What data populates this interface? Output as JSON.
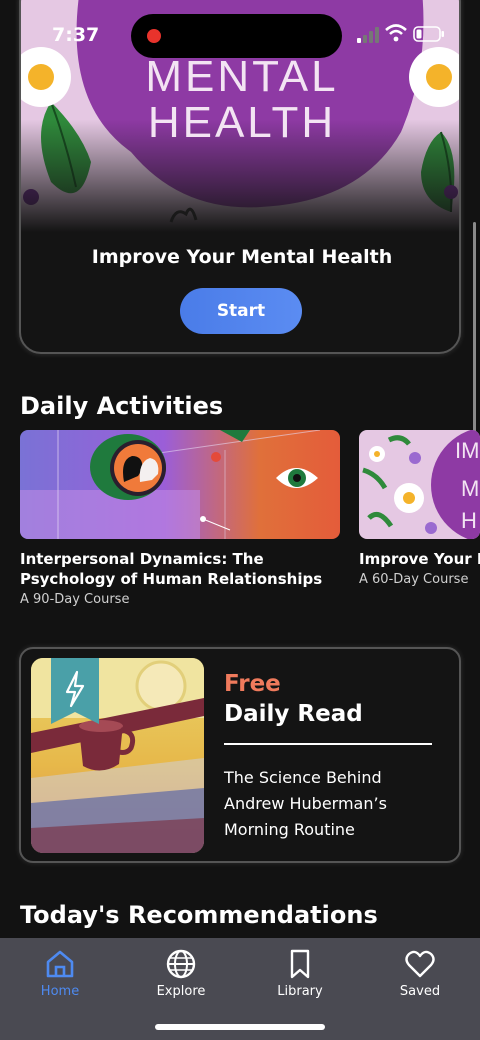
{
  "status_bar": {
    "time": "7:37"
  },
  "hero": {
    "art_text_line1": "MENTAL",
    "art_text_line2": "HEALTH",
    "title": "Improve Your Mental Health",
    "button_label": "Start"
  },
  "daily_activities": {
    "heading": "Daily Activities",
    "courses": [
      {
        "title": "Interpersonal Dynamics: The Psychology of Human Relationships",
        "subtitle": "A 90-Day Course"
      },
      {
        "title": "Improve Your M",
        "subtitle": "A 60-Day Course"
      }
    ]
  },
  "daily_read": {
    "tag": "Free",
    "label": "Daily Read",
    "article": "The Science Behind Andrew Huberman’s Morning Routine",
    "icon": "lightning-bolt-icon"
  },
  "recommendations": {
    "heading": "Today's Recommendations"
  },
  "tab_bar": {
    "active_color": "#4e8af0",
    "tabs": [
      {
        "label": "Home",
        "icon": "home-icon"
      },
      {
        "label": "Explore",
        "icon": "globe-icon"
      },
      {
        "label": "Library",
        "icon": "bookmark-icon"
      },
      {
        "label": "Saved",
        "icon": "heart-icon"
      }
    ]
  }
}
